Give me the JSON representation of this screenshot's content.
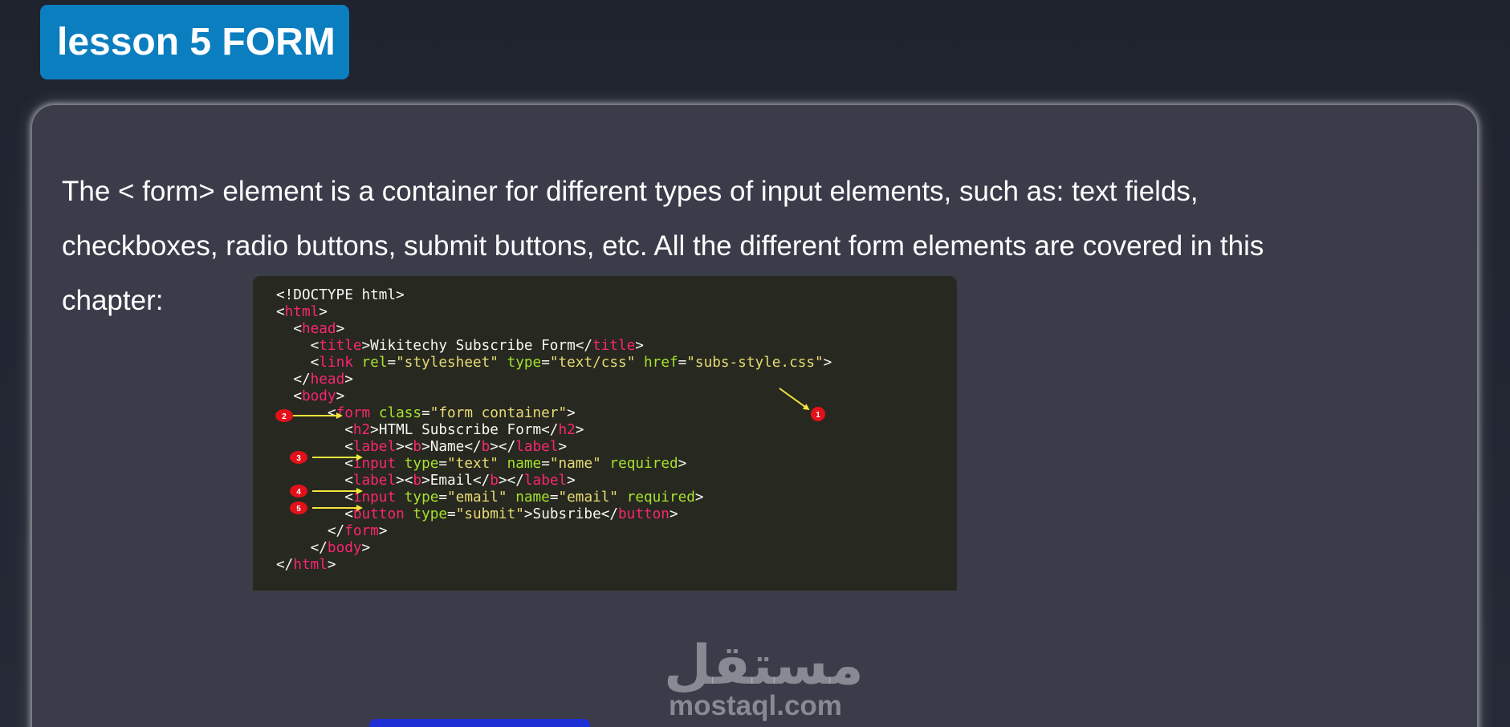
{
  "header": {
    "title": "lesson 5 FORM"
  },
  "content": {
    "intro_lines": [
      "The < form> element is a container for different types of input elements, such as: text fields,",
      "checkboxes, radio buttons, submit buttons, etc. All the different form elements are covered in this",
      "chapter:"
    ]
  },
  "code_example": {
    "lines": [
      {
        "indent": "",
        "parts": [
          {
            "t": "tx",
            "v": "<!DOCTYPE html>"
          }
        ]
      },
      {
        "indent": "",
        "parts": [
          {
            "t": "tx",
            "v": "<"
          },
          {
            "t": "tk",
            "v": "html"
          },
          {
            "t": "tx",
            "v": ">"
          }
        ]
      },
      {
        "indent": "  ",
        "parts": [
          {
            "t": "tx",
            "v": "<"
          },
          {
            "t": "tk",
            "v": "head"
          },
          {
            "t": "tx",
            "v": ">"
          }
        ]
      },
      {
        "indent": "    ",
        "parts": [
          {
            "t": "tx",
            "v": "<"
          },
          {
            "t": "tk",
            "v": "title"
          },
          {
            "t": "tx",
            "v": ">Wikitechy Subscribe Form</"
          },
          {
            "t": "tk",
            "v": "title"
          },
          {
            "t": "tx",
            "v": ">"
          }
        ]
      },
      {
        "indent": "    ",
        "parts": [
          {
            "t": "tx",
            "v": "<"
          },
          {
            "t": "tk",
            "v": "link"
          },
          {
            "t": "tx",
            "v": " "
          },
          {
            "t": "at",
            "v": "rel"
          },
          {
            "t": "tx",
            "v": "="
          },
          {
            "t": "st",
            "v": "\"stylesheet\""
          },
          {
            "t": "tx",
            "v": " "
          },
          {
            "t": "at",
            "v": "type"
          },
          {
            "t": "tx",
            "v": "="
          },
          {
            "t": "st",
            "v": "\"text/css\""
          },
          {
            "t": "tx",
            "v": " "
          },
          {
            "t": "at",
            "v": "href"
          },
          {
            "t": "tx",
            "v": "="
          },
          {
            "t": "st",
            "v": "\"subs-style.css\""
          },
          {
            "t": "tx",
            "v": ">"
          }
        ]
      },
      {
        "indent": "  ",
        "parts": [
          {
            "t": "tx",
            "v": "</"
          },
          {
            "t": "tk",
            "v": "head"
          },
          {
            "t": "tx",
            "v": ">"
          }
        ]
      },
      {
        "indent": "  ",
        "parts": [
          {
            "t": "tx",
            "v": "<"
          },
          {
            "t": "tk",
            "v": "body"
          },
          {
            "t": "tx",
            "v": ">"
          }
        ]
      },
      {
        "indent": "      ",
        "parts": [
          {
            "t": "tx",
            "v": "<"
          },
          {
            "t": "tk",
            "v": "form"
          },
          {
            "t": "tx",
            "v": " "
          },
          {
            "t": "at",
            "v": "class"
          },
          {
            "t": "tx",
            "v": "="
          },
          {
            "t": "st",
            "v": "\"form container\""
          },
          {
            "t": "tx",
            "v": ">"
          }
        ]
      },
      {
        "indent": "        ",
        "parts": [
          {
            "t": "tx",
            "v": "<"
          },
          {
            "t": "tk",
            "v": "h2"
          },
          {
            "t": "tx",
            "v": ">HTML Subscribe Form</"
          },
          {
            "t": "tk",
            "v": "h2"
          },
          {
            "t": "tx",
            "v": ">"
          }
        ]
      },
      {
        "indent": "        ",
        "parts": [
          {
            "t": "tx",
            "v": "<"
          },
          {
            "t": "tk",
            "v": "label"
          },
          {
            "t": "tx",
            "v": "><"
          },
          {
            "t": "tk",
            "v": "b"
          },
          {
            "t": "tx",
            "v": ">Name</"
          },
          {
            "t": "tk",
            "v": "b"
          },
          {
            "t": "tx",
            "v": "></"
          },
          {
            "t": "tk",
            "v": "label"
          },
          {
            "t": "tx",
            "v": ">"
          }
        ]
      },
      {
        "indent": "        ",
        "parts": [
          {
            "t": "tx",
            "v": "<"
          },
          {
            "t": "tk",
            "v": "input"
          },
          {
            "t": "tx",
            "v": " "
          },
          {
            "t": "at",
            "v": "type"
          },
          {
            "t": "tx",
            "v": "="
          },
          {
            "t": "st",
            "v": "\"text\""
          },
          {
            "t": "tx",
            "v": " "
          },
          {
            "t": "at",
            "v": "name"
          },
          {
            "t": "tx",
            "v": "="
          },
          {
            "t": "st",
            "v": "\"name\""
          },
          {
            "t": "tx",
            "v": " "
          },
          {
            "t": "at",
            "v": "required"
          },
          {
            "t": "tx",
            "v": ">"
          }
        ]
      },
      {
        "indent": "        ",
        "parts": [
          {
            "t": "tx",
            "v": "<"
          },
          {
            "t": "tk",
            "v": "label"
          },
          {
            "t": "tx",
            "v": "><"
          },
          {
            "t": "tk",
            "v": "b"
          },
          {
            "t": "tx",
            "v": ">Email</"
          },
          {
            "t": "tk",
            "v": "b"
          },
          {
            "t": "tx",
            "v": "></"
          },
          {
            "t": "tk",
            "v": "label"
          },
          {
            "t": "tx",
            "v": ">"
          }
        ]
      },
      {
        "indent": "        ",
        "parts": [
          {
            "t": "tx",
            "v": "<"
          },
          {
            "t": "tk",
            "v": "input"
          },
          {
            "t": "tx",
            "v": " "
          },
          {
            "t": "at",
            "v": "type"
          },
          {
            "t": "tx",
            "v": "="
          },
          {
            "t": "st",
            "v": "\"email\""
          },
          {
            "t": "tx",
            "v": " "
          },
          {
            "t": "at",
            "v": "name"
          },
          {
            "t": "tx",
            "v": "="
          },
          {
            "t": "st",
            "v": "\"email\""
          },
          {
            "t": "tx",
            "v": " "
          },
          {
            "t": "at",
            "v": "required"
          },
          {
            "t": "tx",
            "v": ">"
          }
        ]
      },
      {
        "indent": "        ",
        "parts": [
          {
            "t": "tx",
            "v": "<"
          },
          {
            "t": "tk",
            "v": "button"
          },
          {
            "t": "tx",
            "v": " "
          },
          {
            "t": "at",
            "v": "type"
          },
          {
            "t": "tx",
            "v": "="
          },
          {
            "t": "st",
            "v": "\"submit\""
          },
          {
            "t": "tx",
            "v": ">Subsribe</"
          },
          {
            "t": "tk",
            "v": "button"
          },
          {
            "t": "tx",
            "v": ">"
          }
        ]
      },
      {
        "indent": "      ",
        "parts": [
          {
            "t": "tx",
            "v": "</"
          },
          {
            "t": "tk",
            "v": "form"
          },
          {
            "t": "tx",
            "v": ">"
          }
        ]
      },
      {
        "indent": "    ",
        "parts": [
          {
            "t": "tx",
            "v": "</"
          },
          {
            "t": "tk",
            "v": "body"
          },
          {
            "t": "tx",
            "v": ">"
          }
        ]
      },
      {
        "indent": "",
        "parts": [
          {
            "t": "tx",
            "v": "</"
          },
          {
            "t": "tk",
            "v": "html"
          },
          {
            "t": "tx",
            "v": ">"
          }
        ]
      }
    ],
    "callouts": [
      "1",
      "2",
      "3",
      "4",
      "5"
    ]
  },
  "watermark": {
    "logo": "مستقل",
    "text": "mostaql.com"
  },
  "colors": {
    "badge": "#0b7ec0",
    "card": "#3a3d49",
    "code_bg": "#27281f",
    "tag": "#f92672",
    "attr": "#a6e22e",
    "string": "#e6db74",
    "callout": "#e3101a",
    "arrow": "#f2e63a"
  }
}
